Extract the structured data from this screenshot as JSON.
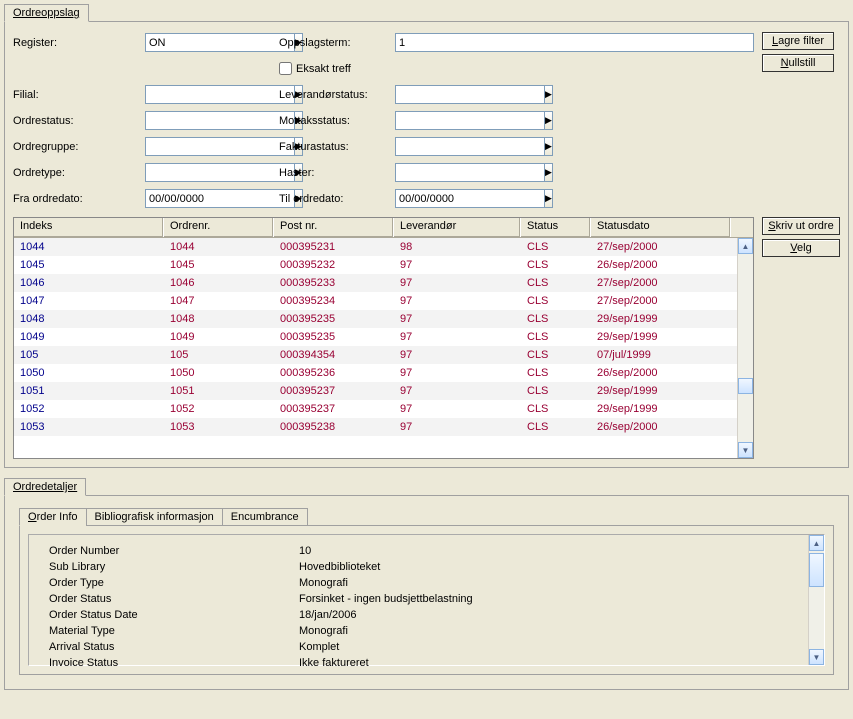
{
  "top_tab": "Ordreoppslag",
  "labels": {
    "register": "Register:",
    "oppslagsterm": "Oppslagsterm:",
    "eksakt": "Eksakt treff",
    "filial": "Filial:",
    "ordrestatus": "Ordrestatus:",
    "ordregruppe": "Ordregruppe:",
    "ordretype": "Ordretype:",
    "fra_ordredato": "Fra ordredato:",
    "leverandorstatus": "Leverandørstatus:",
    "mottaksstatus": "Mottaksstatus:",
    "fakturastatus": "Fakturastatus:",
    "haster": "Haster:",
    "til_ordredato": "Til ordredato:"
  },
  "fields": {
    "register": "ON",
    "oppslagsterm": "1",
    "fra_date": "00/00/0000",
    "til_date": "00/00/0000"
  },
  "buttons": {
    "lagre_filter": "Lagre filter",
    "nullstill": "Nullstill",
    "skriv_ordre": "Skriv ut ordre",
    "velg": "Velg"
  },
  "grid": {
    "headers": {
      "indeks": "Indeks",
      "ordrenr": "Ordrenr.",
      "postnr": "Post nr.",
      "leverandor": "Leverandør",
      "status": "Status",
      "statusdato": "Statusdato"
    },
    "rows": [
      {
        "idx": "1044",
        "ord": "1044",
        "post": "000395231",
        "lev": "98",
        "stat": "CLS",
        "dato": "27/sep/2000"
      },
      {
        "idx": "1045",
        "ord": "1045",
        "post": "000395232",
        "lev": "97",
        "stat": "CLS",
        "dato": "26/sep/2000"
      },
      {
        "idx": "1046",
        "ord": "1046",
        "post": "000395233",
        "lev": "97",
        "stat": "CLS",
        "dato": "27/sep/2000"
      },
      {
        "idx": "1047",
        "ord": "1047",
        "post": "000395234",
        "lev": "97",
        "stat": "CLS",
        "dato": "27/sep/2000"
      },
      {
        "idx": "1048",
        "ord": "1048",
        "post": "000395235",
        "lev": "97",
        "stat": "CLS",
        "dato": "29/sep/1999"
      },
      {
        "idx": "1049",
        "ord": "1049",
        "post": "000395235",
        "lev": "97",
        "stat": "CLS",
        "dato": "29/sep/1999"
      },
      {
        "idx": "105",
        "ord": "105",
        "post": "000394354",
        "lev": "97",
        "stat": "CLS",
        "dato": "07/jul/1999"
      },
      {
        "idx": "1050",
        "ord": "1050",
        "post": "000395236",
        "lev": "97",
        "stat": "CLS",
        "dato": "26/sep/2000"
      },
      {
        "idx": "1051",
        "ord": "1051",
        "post": "000395237",
        "lev": "97",
        "stat": "CLS",
        "dato": "29/sep/1999"
      },
      {
        "idx": "1052",
        "ord": "1052",
        "post": "000395237",
        "lev": "97",
        "stat": "CLS",
        "dato": "29/sep/1999"
      },
      {
        "idx": "1053",
        "ord": "1053",
        "post": "000395238",
        "lev": "97",
        "stat": "CLS",
        "dato": "26/sep/2000"
      }
    ]
  },
  "lower_tab": "Ordredetaljer",
  "detail_tabs": {
    "order_info": "Order Info",
    "bibliografisk": "Bibliografisk informasjon",
    "encumbrance": "Encumbrance"
  },
  "details": {
    "order_number_l": "Order Number",
    "order_number_v": "10",
    "sub_library_l": "Sub Library",
    "sub_library_v": "Hovedbiblioteket",
    "order_type_l": "Order Type",
    "order_type_v": "Monografi",
    "order_status_l": "Order Status",
    "order_status_v": "Forsinket - ingen budsjettbelastning",
    "order_status_date_l": "Order Status Date",
    "order_status_date_v": "18/jan/2006",
    "material_type_l": "Material Type",
    "material_type_v": "Monografi",
    "arrival_status_l": "Arrival Status",
    "arrival_status_v": "Komplet",
    "invoice_status_l": "Invoice Status",
    "invoice_status_v": "Ikke faktureret"
  }
}
